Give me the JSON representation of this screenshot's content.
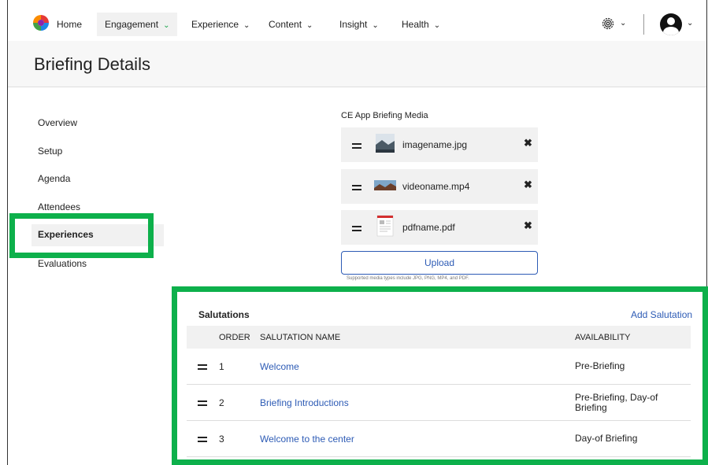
{
  "nav": {
    "home": "Home",
    "engagement": "Engagement",
    "experience": "Experience",
    "content": "Content",
    "insight": "Insight",
    "health": "Health"
  },
  "page_title": "Briefing Details",
  "sidebar": {
    "items": [
      {
        "label": "Overview"
      },
      {
        "label": "Setup"
      },
      {
        "label": "Agenda"
      },
      {
        "label": "Attendees"
      },
      {
        "label": "Experiences"
      },
      {
        "label": "Evaluations"
      }
    ],
    "active": "Experiences"
  },
  "media": {
    "title": "CE App Briefing Media",
    "files": [
      {
        "name": "imagename.jpg"
      },
      {
        "name": "videoname.mp4"
      },
      {
        "name": "pdfname.pdf"
      }
    ],
    "upload_label": "Upload",
    "note": "Supported media types include JPG, PNG, MP4, and PDF."
  },
  "salutations": {
    "title": "Salutations",
    "add_label": "Add Salutation",
    "columns": {
      "order": "ORDER",
      "name": "SALUTATION NAME",
      "availability": "AVAILABILITY"
    },
    "rows": [
      {
        "order": "1",
        "name": "Welcome",
        "availability": "Pre-Briefing"
      },
      {
        "order": "2",
        "name": "Briefing Introductions",
        "availability": "Pre-Briefing, Day-of Briefing"
      },
      {
        "order": "3",
        "name": "Welcome to the center",
        "availability": "Day-of Briefing"
      }
    ]
  },
  "colors": {
    "highlight": "#0db04b",
    "link": "#2d5bb5"
  }
}
